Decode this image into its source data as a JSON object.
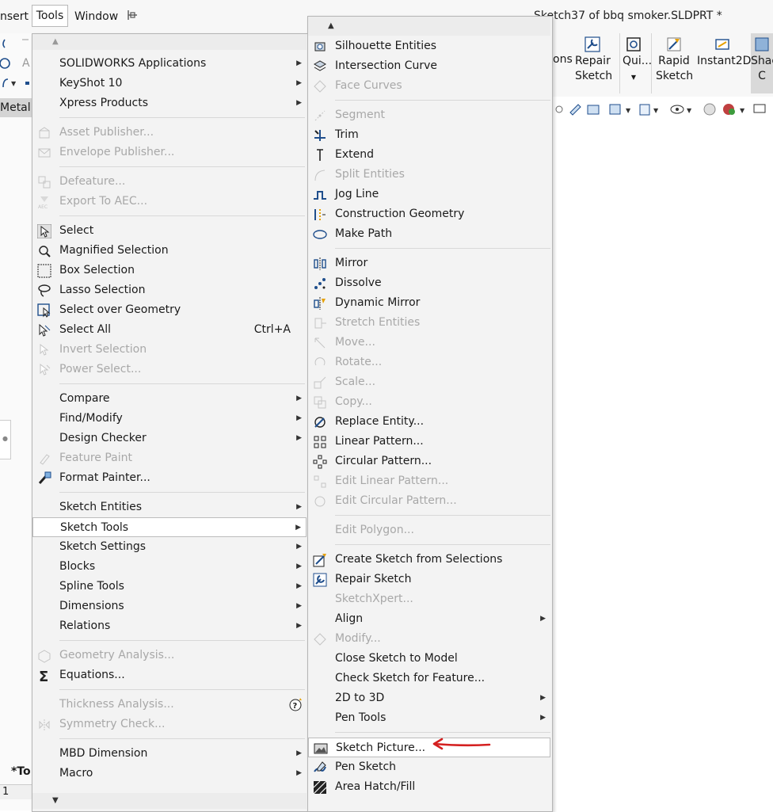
{
  "menubar": {
    "insert_label": "nsert",
    "tools_label": "Tools",
    "window_label": "Window",
    "title": "Sketch37 of bbq smoker.SLDPRT *"
  },
  "ribbon": {
    "ions_label": "ons",
    "repair_sketch_line1": "Repair",
    "repair_sketch_line2": "Sketch",
    "quick_label": "Qui...",
    "rapid_line1": "Rapid",
    "rapid_line2": "Sketch",
    "instant2d_label": "Instant2D",
    "shade_line1": "Shac",
    "shade_line2": "C"
  },
  "leftpanel": {
    "metal_tab": "Metal",
    "to_label": "*To",
    "bottom_tab": "1"
  },
  "tools_menu": {
    "items": [
      {
        "label": "SOLIDWORKS Applications",
        "disabled": false,
        "submenu": true,
        "icon": ""
      },
      {
        "label": "KeyShot 10",
        "disabled": false,
        "submenu": true,
        "icon": ""
      },
      {
        "label": "Xpress Products",
        "disabled": false,
        "submenu": true,
        "icon": ""
      },
      {
        "label": "Asset Publisher...",
        "disabled": true,
        "submenu": false,
        "icon": "asset-publisher-icon"
      },
      {
        "label": "Envelope Publisher...",
        "disabled": true,
        "submenu": false,
        "icon": "envelope-publisher-icon"
      },
      {
        "label": "Defeature...",
        "disabled": true,
        "submenu": false,
        "icon": "defeature-icon"
      },
      {
        "label": "Export To AEC...",
        "disabled": true,
        "submenu": false,
        "icon": "export-aec-icon"
      },
      {
        "label": "Select",
        "disabled": false,
        "submenu": false,
        "icon": "select-arrow-icon"
      },
      {
        "label": "Magnified Selection",
        "disabled": false,
        "submenu": false,
        "icon": "magnified-selection-icon"
      },
      {
        "label": "Box Selection",
        "disabled": false,
        "submenu": false,
        "icon": "box-selection-icon"
      },
      {
        "label": "Lasso Selection",
        "disabled": false,
        "submenu": false,
        "icon": "lasso-icon"
      },
      {
        "label": "Select over Geometry",
        "disabled": false,
        "submenu": false,
        "icon": "select-over-geometry-icon"
      },
      {
        "label": "Select All",
        "disabled": false,
        "submenu": false,
        "icon": "select-all-icon",
        "shortcut": "Ctrl+A"
      },
      {
        "label": "Invert Selection",
        "disabled": true,
        "submenu": false,
        "icon": "invert-selection-icon"
      },
      {
        "label": "Power Select...",
        "disabled": true,
        "submenu": false,
        "icon": "power-select-icon"
      },
      {
        "label": "Compare",
        "disabled": false,
        "submenu": true,
        "icon": ""
      },
      {
        "label": "Find/Modify",
        "disabled": false,
        "submenu": true,
        "icon": ""
      },
      {
        "label": "Design Checker",
        "disabled": false,
        "submenu": true,
        "icon": ""
      },
      {
        "label": "Feature Paint",
        "disabled": true,
        "submenu": false,
        "icon": "feature-paint-icon"
      },
      {
        "label": "Format Painter...",
        "disabled": false,
        "submenu": false,
        "icon": "format-painter-icon"
      },
      {
        "label": "Sketch Entities",
        "disabled": false,
        "submenu": true,
        "icon": ""
      },
      {
        "label": "Sketch Tools",
        "disabled": false,
        "submenu": true,
        "icon": "",
        "highlighted": true
      },
      {
        "label": "Sketch Settings",
        "disabled": false,
        "submenu": true,
        "icon": ""
      },
      {
        "label": "Blocks",
        "disabled": false,
        "submenu": true,
        "icon": ""
      },
      {
        "label": "Spline Tools",
        "disabled": false,
        "submenu": true,
        "icon": ""
      },
      {
        "label": "Dimensions",
        "disabled": false,
        "submenu": true,
        "icon": ""
      },
      {
        "label": "Relations",
        "disabled": false,
        "submenu": true,
        "icon": ""
      },
      {
        "label": "Geometry Analysis...",
        "disabled": true,
        "submenu": false,
        "icon": "geometry-analysis-icon"
      },
      {
        "label": "Equations...",
        "disabled": false,
        "submenu": false,
        "icon": "sigma-icon"
      },
      {
        "label": "Thickness Analysis...",
        "disabled": true,
        "submenu": false,
        "icon": "",
        "help": true
      },
      {
        "label": "Symmetry Check...",
        "disabled": true,
        "submenu": false,
        "icon": "symmetry-check-icon"
      },
      {
        "label": "MBD Dimension",
        "disabled": false,
        "submenu": true,
        "icon": ""
      },
      {
        "label": "Macro",
        "disabled": false,
        "submenu": true,
        "icon": ""
      }
    ]
  },
  "sketch_tools_menu": {
    "items": [
      {
        "label": "Silhouette Entities",
        "disabled": false,
        "submenu": false,
        "icon": "silhouette-icon"
      },
      {
        "label": "Intersection Curve",
        "disabled": false,
        "submenu": false,
        "icon": "intersection-curve-icon"
      },
      {
        "label": "Face Curves",
        "disabled": true,
        "submenu": false,
        "icon": "face-curves-icon"
      },
      {
        "label": "Segment",
        "disabled": true,
        "submenu": false,
        "icon": "segment-icon"
      },
      {
        "label": "Trim",
        "disabled": false,
        "submenu": false,
        "icon": "trim-icon"
      },
      {
        "label": "Extend",
        "disabled": false,
        "submenu": false,
        "icon": "extend-icon"
      },
      {
        "label": "Split Entities",
        "disabled": true,
        "submenu": false,
        "icon": "split-entities-icon"
      },
      {
        "label": "Jog Line",
        "disabled": false,
        "submenu": false,
        "icon": "jog-line-icon"
      },
      {
        "label": "Construction Geometry",
        "disabled": false,
        "submenu": false,
        "icon": "construction-geometry-icon"
      },
      {
        "label": "Make Path",
        "disabled": false,
        "submenu": false,
        "icon": "make-path-icon"
      },
      {
        "label": "Mirror",
        "disabled": false,
        "submenu": false,
        "icon": "mirror-icon"
      },
      {
        "label": "Dissolve",
        "disabled": false,
        "submenu": false,
        "icon": "dissolve-icon"
      },
      {
        "label": "Dynamic Mirror",
        "disabled": false,
        "submenu": false,
        "icon": "dynamic-mirror-icon"
      },
      {
        "label": "Stretch Entities",
        "disabled": true,
        "submenu": false,
        "icon": "stretch-icon"
      },
      {
        "label": "Move...",
        "disabled": true,
        "submenu": false,
        "icon": "move-icon"
      },
      {
        "label": "Rotate...",
        "disabled": true,
        "submenu": false,
        "icon": "rotate-icon"
      },
      {
        "label": "Scale...",
        "disabled": true,
        "submenu": false,
        "icon": "scale-icon"
      },
      {
        "label": "Copy...",
        "disabled": true,
        "submenu": false,
        "icon": "copy-icon"
      },
      {
        "label": "Replace Entity...",
        "disabled": false,
        "submenu": false,
        "icon": "replace-entity-icon"
      },
      {
        "label": "Linear Pattern...",
        "disabled": false,
        "submenu": false,
        "icon": "linear-pattern-icon"
      },
      {
        "label": "Circular Pattern...",
        "disabled": false,
        "submenu": false,
        "icon": "circular-pattern-icon"
      },
      {
        "label": "Edit Linear Pattern...",
        "disabled": true,
        "submenu": false,
        "icon": "edit-linear-pattern-icon"
      },
      {
        "label": "Edit Circular Pattern...",
        "disabled": true,
        "submenu": false,
        "icon": "edit-circular-pattern-icon"
      },
      {
        "label": "Edit Polygon...",
        "disabled": true,
        "submenu": false,
        "icon": ""
      },
      {
        "label": "Create Sketch from Selections",
        "disabled": false,
        "submenu": false,
        "icon": "create-sketch-icon"
      },
      {
        "label": "Repair Sketch",
        "disabled": false,
        "submenu": false,
        "icon": "repair-sketch-icon"
      },
      {
        "label": "SketchXpert...",
        "disabled": true,
        "submenu": false,
        "icon": ""
      },
      {
        "label": "Align",
        "disabled": false,
        "submenu": true,
        "icon": ""
      },
      {
        "label": "Modify...",
        "disabled": true,
        "submenu": false,
        "icon": "modify-icon"
      },
      {
        "label": "Close Sketch to Model",
        "disabled": false,
        "submenu": false,
        "icon": ""
      },
      {
        "label": "Check Sketch for Feature...",
        "disabled": false,
        "submenu": false,
        "icon": ""
      },
      {
        "label": "2D to 3D",
        "disabled": false,
        "submenu": true,
        "icon": ""
      },
      {
        "label": "Pen Tools",
        "disabled": false,
        "submenu": true,
        "icon": ""
      },
      {
        "label": "Sketch Picture...",
        "disabled": false,
        "submenu": false,
        "icon": "sketch-picture-icon",
        "highlighted": true
      },
      {
        "label": "Pen Sketch",
        "disabled": false,
        "submenu": false,
        "icon": "pen-sketch-icon"
      },
      {
        "label": "Area Hatch/Fill",
        "disabled": false,
        "submenu": false,
        "icon": "area-hatch-icon"
      }
    ]
  },
  "colors": {
    "annotation_arrow": "#d42020",
    "icon_blue": "#1f4e8c",
    "disabled_text": "#a8a8a8"
  }
}
